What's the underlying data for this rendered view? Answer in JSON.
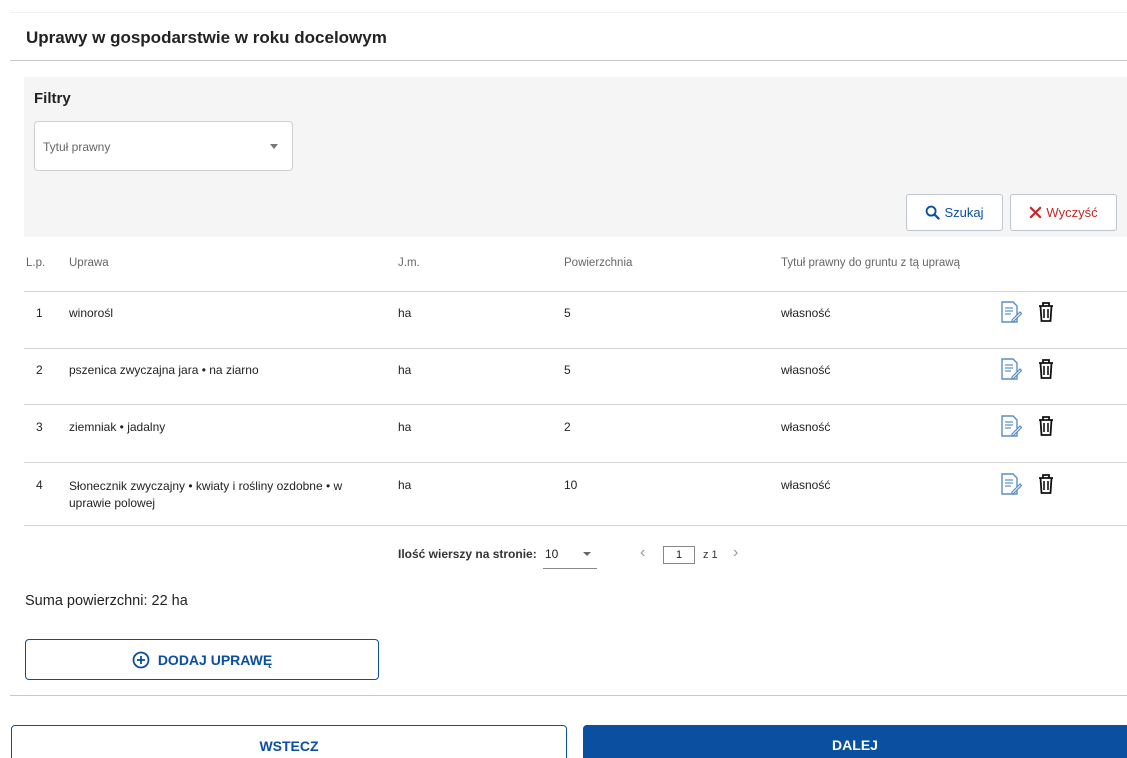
{
  "page": {
    "title": "Uprawy w gospodarstwie w roku docelowym"
  },
  "filters": {
    "title": "Filtry",
    "legal_title_placeholder": "Tytuł prawny",
    "search_label": "Szukaj",
    "clear_label": "Wyczyść"
  },
  "table": {
    "headers": {
      "lp": "L.p.",
      "crop": "Uprawa",
      "unit": "J.m.",
      "area": "Powierzchnia",
      "legal_title": "Tytuł prawny do gruntu z tą uprawą"
    },
    "rows": [
      {
        "lp": "1",
        "crop": "winorośl",
        "unit": "ha",
        "area": "5",
        "legal_title": "własność"
      },
      {
        "lp": "2",
        "crop": "pszenica zwyczajna jara • na ziarno",
        "unit": "ha",
        "area": "5",
        "legal_title": "własność"
      },
      {
        "lp": "3",
        "crop": "ziemniak • jadalny",
        "unit": "ha",
        "area": "2",
        "legal_title": "własność"
      },
      {
        "lp": "4",
        "crop": "Słonecznik zwyczajny • kwiaty i rośliny ozdobne • w",
        "crop_line2": "uprawie polowej",
        "unit": "ha",
        "area": "10",
        "legal_title": "własność"
      }
    ]
  },
  "pagination": {
    "rows_per_page_label": "Ilość wierszy na stronie:",
    "rows_per_page": "10",
    "current_page": "1",
    "of_total": "z 1",
    "prev_glyph": "‹",
    "next_glyph": "›"
  },
  "summary": {
    "total_area": "Suma powierzchni: 22 ha"
  },
  "actions": {
    "add_crop": "DODAJ UPRAWĘ",
    "back": "WSTECZ",
    "next": "DALEJ"
  },
  "colors": {
    "primary": "#0a4fa0",
    "danger": "#c62828",
    "filters_bg": "#f5f5f5"
  },
  "icons": {
    "search": "search-icon",
    "clear": "close-icon",
    "edit": "edit-icon",
    "delete": "trash-icon",
    "add": "plus-circle-icon"
  }
}
